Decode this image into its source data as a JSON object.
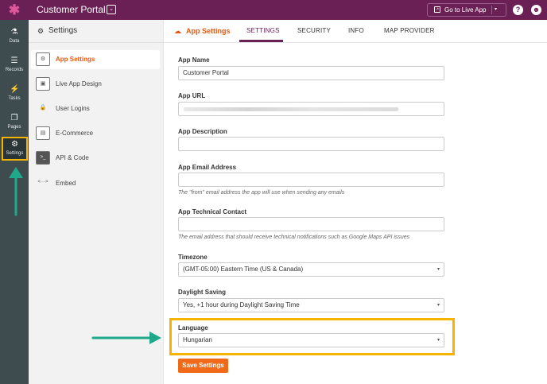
{
  "app": {
    "logo_glyph": "✱",
    "title": "Customer Portal",
    "dropdown_glyph": "⌄"
  },
  "topbar": {
    "go_live_label": "Go to Live App",
    "go_live_icon": "external-link-icon",
    "caret": "▾",
    "help_icon": "?",
    "user_icon": "☻"
  },
  "rail": {
    "items": [
      {
        "label": "Data",
        "icon": "⚗"
      },
      {
        "label": "Records",
        "icon": "☰"
      },
      {
        "label": "Tasks",
        "icon": "⚡"
      },
      {
        "label": "Pages",
        "icon": "❐"
      },
      {
        "label": "Settings",
        "icon": "⚙"
      }
    ]
  },
  "sidebar": {
    "title": "Settings",
    "title_icon": "⚙",
    "items": [
      {
        "label": "App Settings",
        "icon": "⚙"
      },
      {
        "label": "Live App Design",
        "icon": "▣"
      },
      {
        "label": "User Logins",
        "icon": "🔒"
      },
      {
        "label": "E-Commerce",
        "icon": "▤"
      },
      {
        "label": "API & Code",
        "icon": ">_"
      },
      {
        "label": "Embed",
        "icon": "<···>"
      }
    ]
  },
  "tabs": {
    "main_icon": "☁",
    "main_label": "App Settings",
    "items": [
      "SETTINGS",
      "SECURITY",
      "INFO",
      "MAP PROVIDER"
    ]
  },
  "form": {
    "app_name": {
      "label": "App Name",
      "value": "Customer Portal"
    },
    "app_url": {
      "label": "App URL"
    },
    "app_description": {
      "label": "App Description",
      "value": ""
    },
    "app_email": {
      "label": "App Email Address",
      "value": "",
      "hint": "The \"from\" email address the app will use when sending any emails"
    },
    "technical_contact": {
      "label": "App Technical Contact",
      "value": "",
      "hint": "The email address that should receive technical notifications such as Google Maps API issues"
    },
    "timezone": {
      "label": "Timezone",
      "value": "(GMT-05:00) Eastern Time (US & Canada)"
    },
    "daylight_saving": {
      "label": "Daylight Saving",
      "value": "Yes, +1 hour during Daylight Saving Time"
    },
    "language": {
      "label": "Language",
      "value": "Hungarian"
    },
    "save_label": "Save Settings",
    "caret": "▾"
  },
  "colors": {
    "brand": "#6b2055",
    "accent": "#e8570f",
    "highlight": "#f5b400",
    "arrow": "#1fa98a",
    "rail": "#3e4c50"
  }
}
